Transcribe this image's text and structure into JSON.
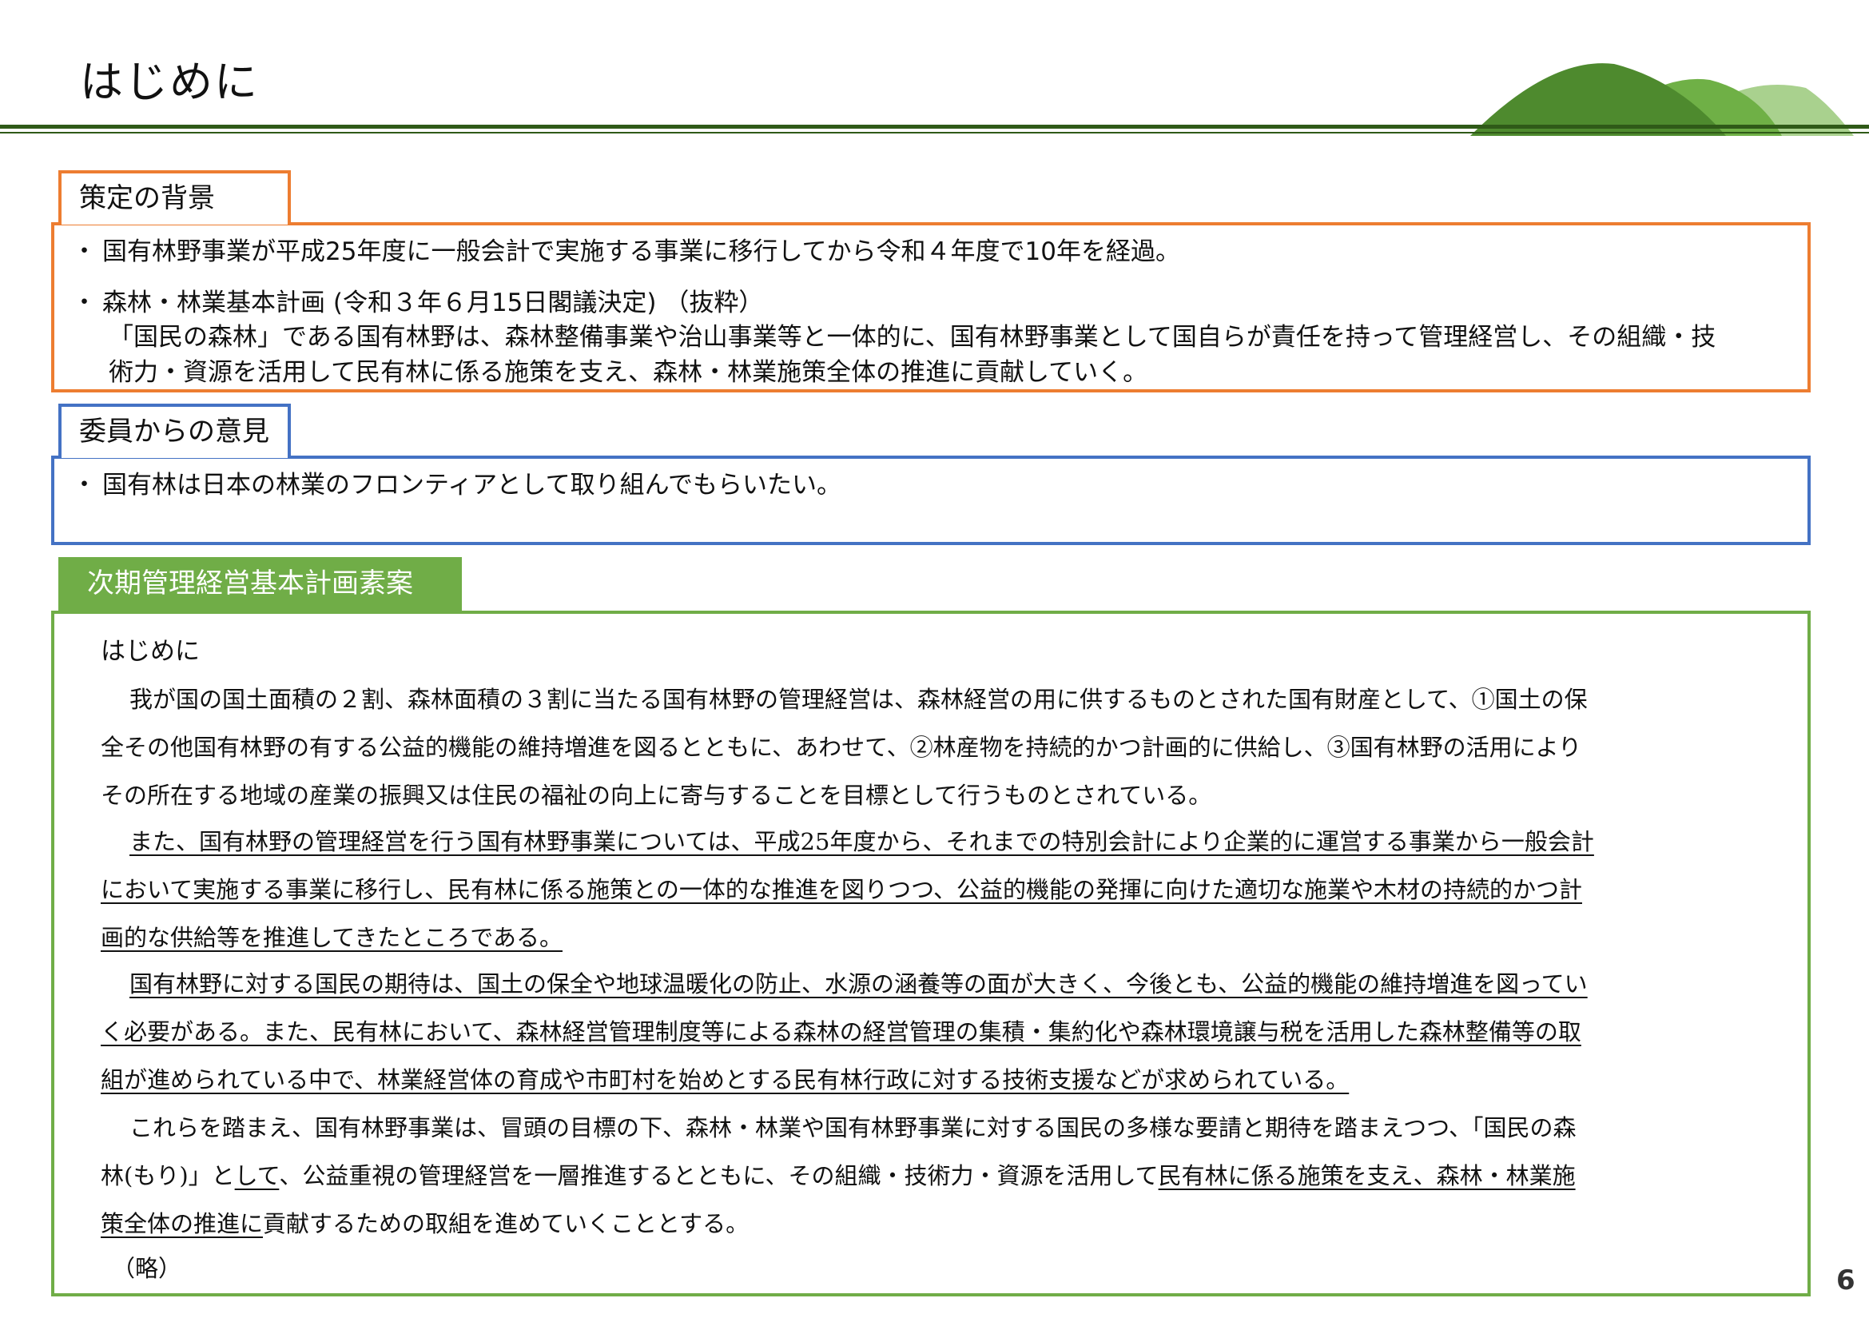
{
  "page": {
    "title": "はじめに",
    "page_number": "6"
  },
  "background": {
    "tab_label": "策定の背景",
    "bullet_1": "国有林野事業が平成25年度に一般会計で実施する事業に移行してから令和４年度で10年を経過。",
    "bullet_2": "森林・林業基本計画 (令和３年６月15日閣議決定) （抜粋）",
    "bullet_2_line_1": "「国民の森林」である国有林野は、森林整備事業や治山事業等と一体的に、国有林野事業として国自らが責任を持って管理経営し、その組織・技",
    "bullet_2_line_2": "術力・資源を活用して民有林に係る施策を支え、森林・林業施策全体の推進に貢献していく。"
  },
  "opinions": {
    "tab_label": "委員からの意見",
    "bullet_1": "国有林は日本の林業のフロンティアとして取り組んでもらいたい。"
  },
  "draft": {
    "tab_label": "次期管理経営基本計画素案",
    "heading": "はじめに",
    "p1_l1": "我が国の国土面積の２割、森林面積の３割に当たる国有林野の管理経営は、森林経営の用に供するものとされた国有財産として、①国土の保",
    "p1_l2": "全その他国有林野の有する公益的機能の維持増進を図るとともに、あわせて、②林産物を持続的かつ計画的に供給し、③国有林野の活用により",
    "p1_l3": "その所在する地域の産業の振興又は住民の福祉の向上に寄与することを目標として行うものとされている。",
    "p2_l1": "また、国有林野の管理経営を行う国有林野事業については、平成25年度から、それまでの特別会計により企業的に運営する事業から一般会計",
    "p2_l2": "において実施する事業に移行し、民有林に係る施策との一体的な推進を図りつつ、公益的機能の発揮に向けた適切な施業や木材の持続的かつ計",
    "p2_l3": "画的な供給等を推進してきたところである。",
    "p3_l1": "国有林野に対する国民の期待は、国土の保全や地球温暖化の防止、水源の涵養等の面が大きく、今後とも、公益的機能の維持増進を図ってい",
    "p3_l2": "く必要がある。また、民有林において、森林経営管理制度等による森林の経営管理の集積・集約化や森林環境譲与税を活用した森林整備等の取",
    "p3_l3": "組が進められている中で、林業経営体の育成や市町村を始めとする民有林行政に対する技術支援などが求められている。",
    "p4_l1": "これらを踏まえ、国有林野事業は、冒頭の目標の下、森林・林業や国有林野事業に対する国民の多様な要請と期待を踏まえつつ、「国民の森",
    "p4_l2_a": "林(もり)」と",
    "p4_l2_b": "して",
    "p4_l2_c": "、公益重視の管理経営を一層推進するとともに、その組織・技術力・資源を活用して",
    "p4_l2_d": "民有林に係る施策を支え、森林・林業施",
    "p4_l3_a": "策全体の推進に",
    "p4_l3_b": "貢献するための取組を進めていくこととする。",
    "omitted": "（略）"
  },
  "colors": {
    "dark_green": "#2f5a18",
    "hill_dark": "#4e8a2e",
    "hill_mid": "#6fb046",
    "hill_light": "#a9d18e",
    "orange": "#ed7d31",
    "blue": "#4472c4",
    "green": "#70ad47"
  }
}
